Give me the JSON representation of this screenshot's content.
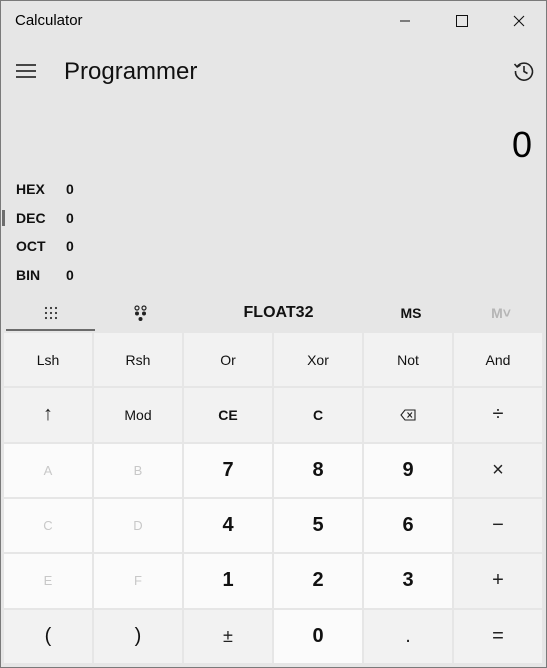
{
  "window": {
    "title": "Calculator"
  },
  "header": {
    "mode": "Programmer"
  },
  "display": {
    "result": "0",
    "radix": [
      {
        "label": "HEX",
        "value": "0"
      },
      {
        "label": "DEC",
        "value": "0"
      },
      {
        "label": "OCT",
        "value": "0"
      },
      {
        "label": "BIN",
        "value": "0"
      }
    ]
  },
  "toolbar": {
    "word_size": "FLOAT32",
    "ms": "MS",
    "memory_view": "M˅"
  },
  "keys": {
    "lsh": "Lsh",
    "rsh": "Rsh",
    "or": "Or",
    "xor": "Xor",
    "not": "Not",
    "and": "And",
    "up": "↑",
    "mod": "Mod",
    "ce": "CE",
    "c": "C",
    "backspace": "⌫",
    "divide": "÷",
    "a": "A",
    "b": "B",
    "seven": "7",
    "eight": "8",
    "nine": "9",
    "multiply": "×",
    "c_hex": "C",
    "d": "D",
    "four": "4",
    "five": "5",
    "six": "6",
    "minus": "−",
    "e": "E",
    "f": "F",
    "one": "1",
    "two": "2",
    "three": "3",
    "plus": "+",
    "lparen": "(",
    "rparen": ")",
    "negate": "±",
    "zero": "0",
    "decimal": ".",
    "equals": "="
  }
}
